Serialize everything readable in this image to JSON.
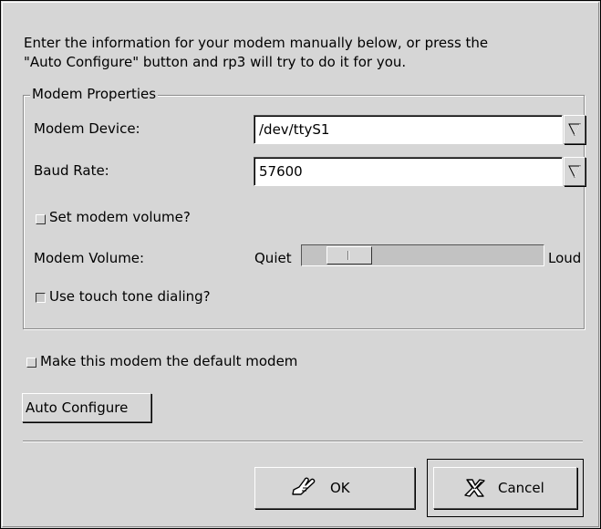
{
  "intro": {
    "text": "Enter the information for your modem manually below, or press the\n\"Auto Configure\" button and rp3 will try to do it for you."
  },
  "modem_properties": {
    "title": "Modem Properties",
    "device": {
      "label": "Modem Device:",
      "value": "/dev/ttyS1"
    },
    "baud_rate": {
      "label": "Baud Rate:",
      "value": "57600"
    },
    "set_volume": {
      "label": "Set modem volume?",
      "checked": false
    },
    "volume": {
      "label": "Modem Volume:",
      "min_label": "Quiet",
      "max_label": "Loud",
      "level": 0.12
    },
    "touch_tone": {
      "label": "Use touch tone dialing?",
      "checked": true
    }
  },
  "default_modem": {
    "label": "Make this modem the default modem",
    "checked": false
  },
  "auto_configure_label": "Auto Configure",
  "buttons": {
    "ok_label": "OK",
    "cancel_label": "Cancel"
  },
  "icons": {
    "dropdown": "chevron-down-icon",
    "ok": "hand-ok-icon",
    "cancel": "x-cancel-icon"
  }
}
